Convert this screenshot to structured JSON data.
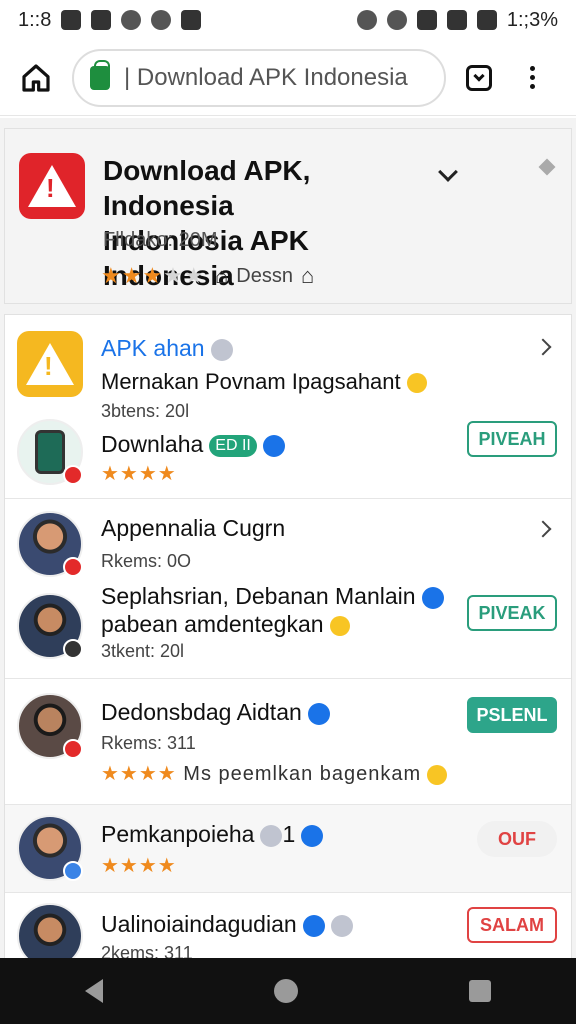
{
  "status": {
    "time": "1::8",
    "battery": "1:;3%"
  },
  "browser": {
    "url": "| Download APK Indonesia"
  },
  "hero": {
    "title_line1": "Download APK, Indonesia",
    "title_line2": "Indonlosia APK Indonesia",
    "sub": "Flldako: 20M",
    "rating": "3 of 5",
    "meta": "Dessn"
  },
  "items": [
    {
      "title": "APK ahan",
      "desc": "Mernakan Povnam Ipagsahant",
      "meta": "3btens: 20l"
    },
    {
      "title": "Downlaha",
      "tag": "ED II",
      "button": "PIVEAH"
    },
    {
      "title": "Appennalia Cugrn",
      "meta": "Rkems: 0O"
    },
    {
      "title_line1": "Seplahsrian, Debanan Manlain",
      "title_line2": "pabean amdentegkan",
      "meta": "3tkent: 20l",
      "button": "PIVEAK"
    },
    {
      "title": "Dedonsbdag Aidtan",
      "meta": "Rkems: 311",
      "stars_text": "Ms peemlkan bagenkam",
      "button": "PSLENL"
    },
    {
      "title": "Pemkanpoieha",
      "tag": "1",
      "button": "OUF"
    },
    {
      "title": "Ualinoiaindagudian",
      "meta": "2kems: 311",
      "button": "SALAM"
    }
  ]
}
